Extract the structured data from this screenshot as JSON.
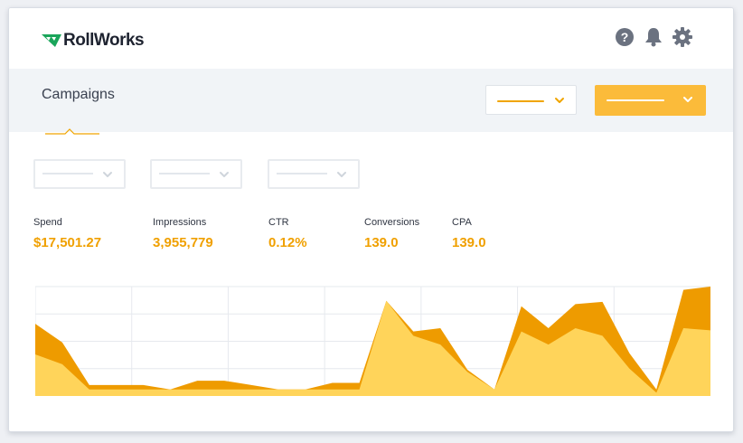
{
  "app": {
    "brand": "RollWorks",
    "accent": "#f0a000",
    "accent_light": "#fbbb3a"
  },
  "header": {
    "icons": [
      "help-icon",
      "bell-icon",
      "gear-icon"
    ]
  },
  "subheader": {
    "title": "Campaigns"
  },
  "metrics": [
    {
      "label": "Spend",
      "value": "$17,501.27"
    },
    {
      "label": "Impressions",
      "value": "3,955,779"
    },
    {
      "label": "CTR",
      "value": "0.12%"
    },
    {
      "label": "Conversions",
      "value": "139.0"
    },
    {
      "label": "CPA",
      "value": "139.0"
    }
  ],
  "chart_data": {
    "type": "area",
    "grid": true,
    "series": [
      {
        "color": "#ee9b00",
        "values": [
          0.66,
          0.49,
          0.1,
          0.1,
          0.1,
          0.06,
          0.14,
          0.14,
          0.1,
          0.06,
          0.06,
          0.12,
          0.12,
          0.87,
          0.59,
          0.62,
          0.24,
          0.06,
          0.82,
          0.62,
          0.84,
          0.86,
          0.39,
          0.06,
          0.97,
          1.0
        ]
      },
      {
        "color": "#ffd45a",
        "values": [
          0.38,
          0.29,
          0.06,
          0.06,
          0.06,
          0.06,
          0.06,
          0.06,
          0.06,
          0.06,
          0.06,
          0.06,
          0.06,
          0.87,
          0.55,
          0.47,
          0.22,
          0.06,
          0.59,
          0.47,
          0.62,
          0.55,
          0.25,
          0.03,
          0.62,
          0.6
        ]
      }
    ]
  }
}
